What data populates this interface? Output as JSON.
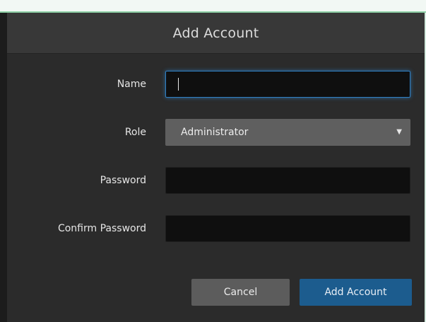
{
  "dialog": {
    "title": "Add Account",
    "fields": {
      "name": {
        "label": "Name",
        "value": ""
      },
      "role": {
        "label": "Role",
        "value": "Administrator"
      },
      "password": {
        "label": "Password",
        "value": ""
      },
      "confirm_password": {
        "label": "Confirm Password",
        "value": ""
      }
    },
    "buttons": {
      "cancel": "Cancel",
      "add_account": "Add Account"
    }
  },
  "colors": {
    "dialog_bg": "#2b2b2b",
    "header_bg": "#383838",
    "input_bg": "#0f0f0f",
    "focus_border": "#2f7fc3",
    "primary_button": "#1c5c8e",
    "secondary_button": "#5c5c5c"
  },
  "icons": {
    "role_dropdown": "chevron-down-icon"
  }
}
